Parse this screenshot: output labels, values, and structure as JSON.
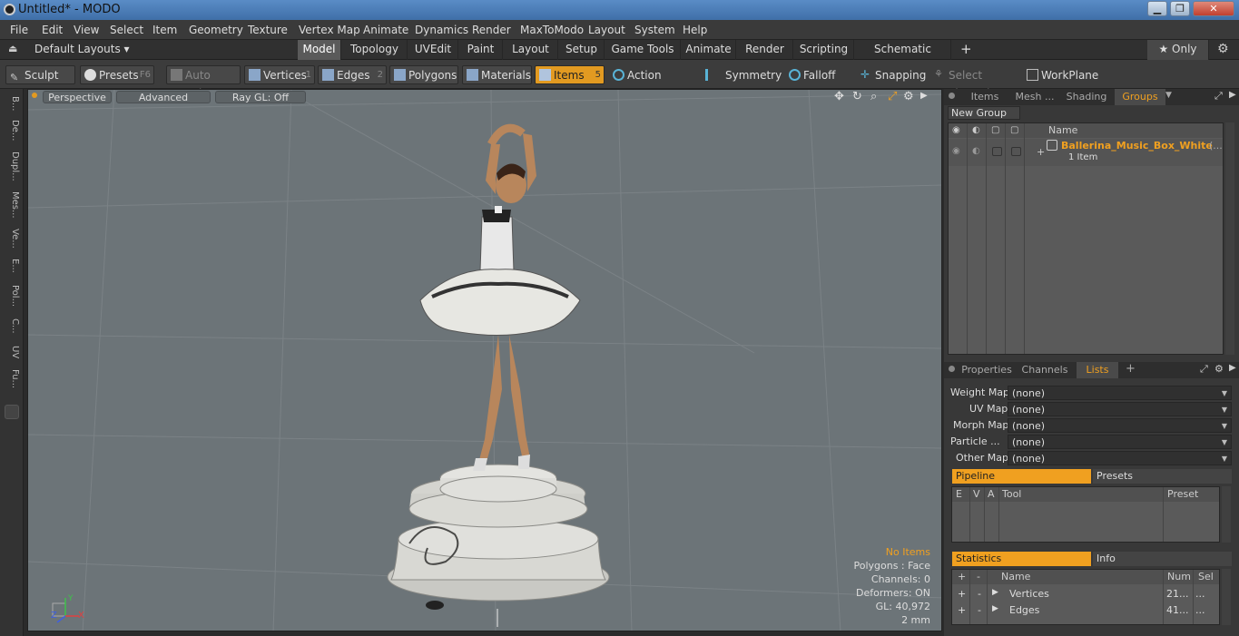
{
  "window": {
    "title": "Untitled* - MODO",
    "minimize": "▁",
    "maximize": "❐",
    "close": "✕"
  },
  "menu": [
    "File",
    "Edit",
    "View",
    "Select",
    "Item",
    "Geometry",
    "Texture",
    "Vertex Map",
    "Animate",
    "Dynamics",
    "Render",
    "MaxToModo",
    "Layout",
    "System",
    "Help"
  ],
  "layout_bar": {
    "default_layouts": "Default Layouts ▾",
    "tabs": [
      "Model",
      "Topology",
      "UVEdit",
      "Paint",
      "Layout",
      "Setup",
      "Game Tools",
      "Animate",
      "Render",
      "Scripting",
      "Schematic Fusion"
    ],
    "active_tab": "Model",
    "add": "+",
    "only": "★ Only"
  },
  "toolbar": {
    "sculpt": "Sculpt",
    "presets": "Presets",
    "presets_key": "F6",
    "auto_select": "Auto Select",
    "vertices": "Vertices",
    "vertices_key": "1",
    "edges": "Edges",
    "edges_key": "2",
    "polygons": "Polygons",
    "materials": "Materials",
    "items": "Items",
    "items_key": "5",
    "action_center": "Action Center",
    "symmetry": "Symmetry",
    "falloff": "Falloff",
    "snapping": "Snapping",
    "select_through": "Select Through",
    "workplane": "WorkPlane"
  },
  "left_tabs": [
    "B...",
    "De...",
    "Dupl...",
    "Mes...",
    "Ve...",
    "E...",
    "Pol...",
    "C...",
    "UV",
    "Fu..."
  ],
  "viewport": {
    "view": "Perspective",
    "mode": "Advanced",
    "raygl": "Ray GL: Off",
    "stats": {
      "no_items": "No Items",
      "polygons": "Polygons : Face",
      "channels": "Channels: 0",
      "deformers": "Deformers: ON",
      "gl": "GL: 40,972",
      "unit": "2 mm"
    },
    "axis": {
      "x": "X",
      "z": "Z",
      "y": "Y"
    }
  },
  "groups_panel": {
    "tabs": [
      "Items",
      "Mesh ...",
      "Shading",
      "Groups"
    ],
    "active_tab": "Groups",
    "new_group": "New Group",
    "col_name": "Name",
    "group_name": "Ballerina_Music_Box_White",
    "group_suffix": "(...",
    "group_count": "1 Item"
  },
  "lists_panel": {
    "tabs": [
      "Properties",
      "Channels",
      "Lists"
    ],
    "active_tab": "Lists",
    "add": "+",
    "maps": [
      {
        "label": "Weight Map",
        "value": "(none)"
      },
      {
        "label": "UV Map",
        "value": "(none)"
      },
      {
        "label": "Morph Map",
        "value": "(none)"
      },
      {
        "label": "Particle  ...",
        "value": "(none)"
      },
      {
        "label": "Other Map",
        "value": "(none)"
      }
    ],
    "pipeline": "Pipeline",
    "presets": "Presets",
    "pipeline_cols": [
      "E",
      "V",
      "A",
      "Tool",
      "Preset"
    ],
    "statistics": "Statistics",
    "info": "Info",
    "stats_cols": [
      "+",
      "-",
      "Name",
      "Num",
      "Sel"
    ],
    "stats_rows": [
      {
        "add": "+",
        "sub": "-",
        "name": "Vertices",
        "num": "21...",
        "sel": "..."
      },
      {
        "add": "+",
        "sub": "-",
        "name": "Edges",
        "num": "41...",
        "sel": "..."
      }
    ]
  },
  "colors": {
    "accent": "#f0a020",
    "viewport_bg": "#6c7478",
    "panel_bg": "#383838"
  }
}
